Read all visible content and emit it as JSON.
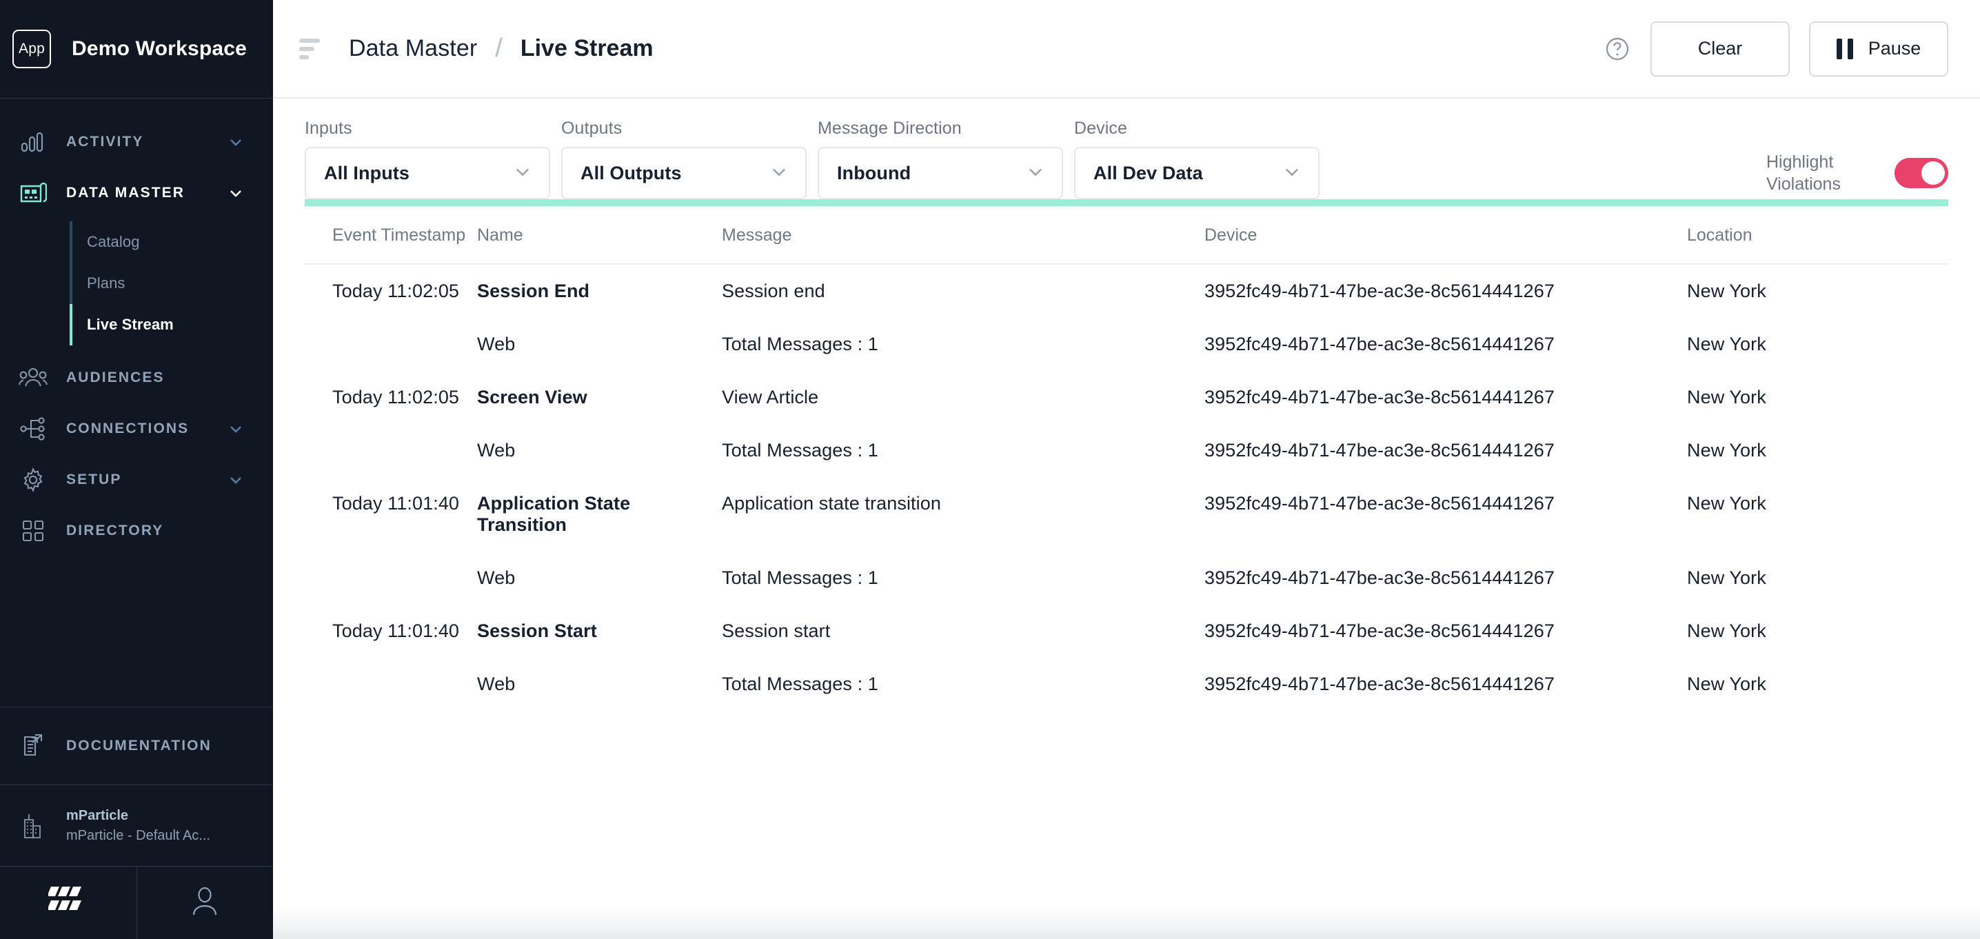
{
  "sidebar": {
    "workspace": {
      "badge": "App",
      "name": "Demo Workspace"
    },
    "groups": [
      {
        "label": "Activity",
        "icon": "bar-chart-icon",
        "expandable": true,
        "active": false
      },
      {
        "label": "Data Master",
        "icon": "blueprint-icon",
        "expandable": true,
        "active": true
      },
      {
        "label": "Audiences",
        "icon": "people-icon",
        "expandable": false,
        "active": false
      },
      {
        "label": "Connections",
        "icon": "nodes-icon",
        "expandable": true,
        "active": false
      },
      {
        "label": "Setup",
        "icon": "gear-icon",
        "expandable": true,
        "active": false
      },
      {
        "label": "Directory",
        "icon": "grid-icon",
        "expandable": false,
        "active": false
      }
    ],
    "data_master_children": [
      {
        "label": "Catalog",
        "active": false
      },
      {
        "label": "Plans",
        "active": false
      },
      {
        "label": "Live Stream",
        "active": true
      }
    ],
    "documentation": {
      "label": "Documentation",
      "icon": "doc-external-icon"
    },
    "account": {
      "icon": "building-icon",
      "name": "mParticle",
      "detail": "mParticle - Default Ac..."
    },
    "footer": {
      "logo_icon": "mparticle-logo-icon",
      "user_icon": "user-icon"
    }
  },
  "topbar": {
    "menu_icon": "hamburger-icon",
    "breadcrumb_parent": "Data Master",
    "breadcrumb_separator": "/",
    "breadcrumb_current": "Live Stream",
    "help_icon": "help-circle-icon",
    "clear_label": "Clear",
    "pause_label": "Pause",
    "pause_icon": "pause-icon"
  },
  "filters": [
    {
      "label": "Inputs",
      "value": "All Inputs",
      "caret": "chevron-down-icon"
    },
    {
      "label": "Outputs",
      "value": "All Outputs",
      "caret": "chevron-down-icon"
    },
    {
      "label": "Message Direction",
      "value": "Inbound",
      "caret": "chevron-down-icon"
    },
    {
      "label": "Device",
      "value": "All Dev Data",
      "caret": "chevron-down-icon"
    }
  ],
  "highlight_violations": {
    "label_line1": "Highlight",
    "label_line2": "Violations",
    "enabled": true,
    "on_color": "#e8416a"
  },
  "colors": {
    "accent_mint": "#9bedd8",
    "sidebar_bg": "#111722",
    "text_dark": "#16202f",
    "toggle_on": "#e8416a"
  },
  "table": {
    "columns": [
      "Event Timestamp",
      "Name",
      "Message",
      "Device",
      "Location"
    ],
    "rows": [
      {
        "timestamp": "Today 11:02:05",
        "name": "Session End",
        "bold": true,
        "message": "Session end",
        "device": "3952fc49-4b71-47be-ac3e-8c5614441267",
        "location": "New York"
      },
      {
        "timestamp": "",
        "name": "Web",
        "bold": false,
        "message": "Total Messages : 1",
        "device": "3952fc49-4b71-47be-ac3e-8c5614441267",
        "location": "New York"
      },
      {
        "timestamp": "Today 11:02:05",
        "name": "Screen View",
        "bold": true,
        "message": "View Article",
        "device": "3952fc49-4b71-47be-ac3e-8c5614441267",
        "location": "New York"
      },
      {
        "timestamp": "",
        "name": "Web",
        "bold": false,
        "message": "Total Messages : 1",
        "device": "3952fc49-4b71-47be-ac3e-8c5614441267",
        "location": "New York"
      },
      {
        "timestamp": "Today 11:01:40",
        "name": "Application State Transition",
        "bold": true,
        "message": "Application state transition",
        "device": "3952fc49-4b71-47be-ac3e-8c5614441267",
        "location": "New York"
      },
      {
        "timestamp": "",
        "name": "Web",
        "bold": false,
        "message": "Total Messages : 1",
        "device": "3952fc49-4b71-47be-ac3e-8c5614441267",
        "location": "New York"
      },
      {
        "timestamp": "Today 11:01:40",
        "name": "Session Start",
        "bold": true,
        "message": "Session start",
        "device": "3952fc49-4b71-47be-ac3e-8c5614441267",
        "location": "New York"
      },
      {
        "timestamp": "",
        "name": "Web",
        "bold": false,
        "message": "Total Messages : 1",
        "device": "3952fc49-4b71-47be-ac3e-8c5614441267",
        "location": "New York"
      }
    ]
  }
}
